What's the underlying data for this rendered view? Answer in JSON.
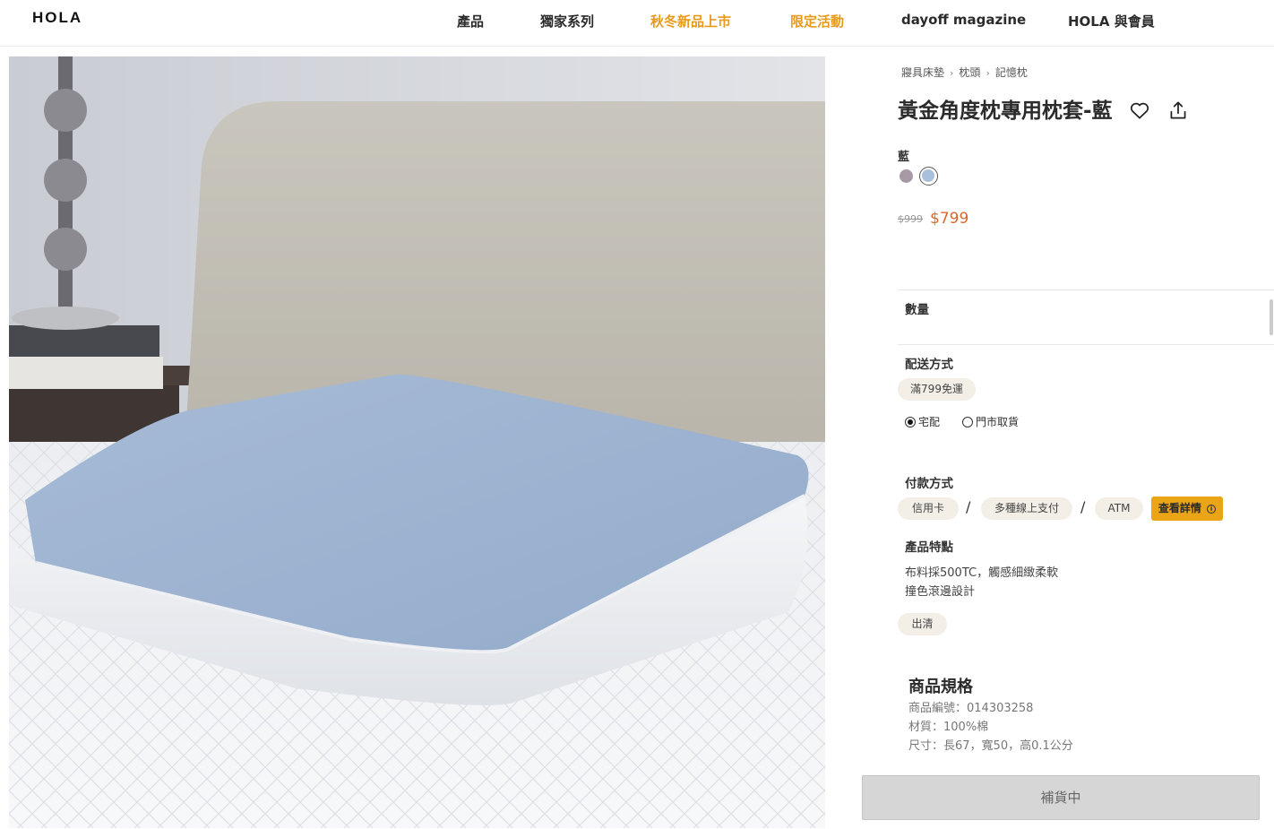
{
  "header": {
    "logo": "HOLA",
    "nav": [
      "產品",
      "獨家系列",
      "秋冬新品上市",
      "限定活動",
      "dayoff magazine",
      "HOLA 與會員"
    ]
  },
  "product": {
    "breadcrumb": [
      "寢具床墊",
      "枕頭",
      "記憶枕"
    ],
    "title": "黃金角度枕專用枕套-藍",
    "color_label": "藍",
    "swatches": [
      "#a89aa4",
      "#a9c0dc"
    ],
    "price_original": "$999",
    "price_sale": "$799",
    "quantity_label": "數量",
    "shipping": {
      "label": "配送方式",
      "badge": "滿799免運",
      "options": [
        "宅配",
        "門市取貨"
      ],
      "selected": "宅配"
    },
    "payment": {
      "label": "付款方式",
      "methods": [
        "信用卡",
        "多種線上支付",
        "ATM"
      ],
      "separator": "/",
      "detail_button": "查看詳情"
    },
    "features": {
      "label": "產品特點",
      "lines": [
        "布料採500TC，觸感細緻柔軟",
        "撞色滾邊設計"
      ],
      "tag": "出清"
    },
    "specs": {
      "title": "商品規格",
      "lines": [
        "商品編號：014303258",
        "材質：100%棉",
        "尺寸：長67，寬50，高0.1公分"
      ]
    },
    "restock_button": "補貨中"
  }
}
